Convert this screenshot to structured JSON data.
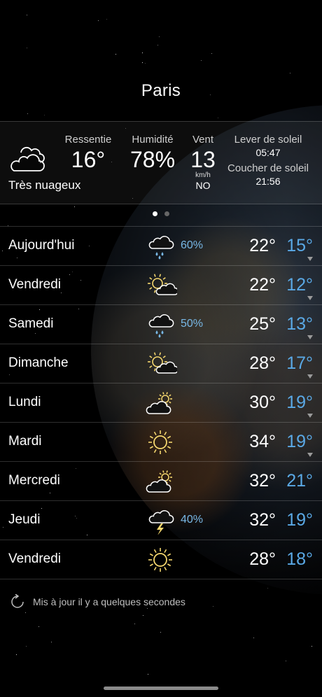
{
  "city": "Paris",
  "current": {
    "condition": "Très nuageux",
    "icon": "cloudy-icon",
    "feels_like_label": "Ressentie",
    "feels_like_value": "16°",
    "humidity_label": "Humidité",
    "humidity_value": "78%",
    "wind_label": "Vent",
    "wind_value": "13",
    "wind_unit": "km/h",
    "wind_dir": "NO",
    "sunrise_label": "Lever de soleil",
    "sunrise_time": "05:47",
    "sunset_label": "Coucher de soleil",
    "sunset_time": "21:56"
  },
  "pager": {
    "pages": 2,
    "active": 1
  },
  "forecast": [
    {
      "day": "Aujourd'hui",
      "icon": "rain-cloud-icon",
      "precip": "60%",
      "high": "22°",
      "low": "15°",
      "expand": true
    },
    {
      "day": "Vendredi",
      "icon": "sun-cloud-icon",
      "precip": "",
      "high": "22°",
      "low": "12°",
      "expand": true
    },
    {
      "day": "Samedi",
      "icon": "rain-cloud-icon",
      "precip": "50%",
      "high": "25°",
      "low": "13°",
      "expand": true
    },
    {
      "day": "Dimanche",
      "icon": "sun-cloud-icon",
      "precip": "",
      "high": "28°",
      "low": "17°",
      "expand": true
    },
    {
      "day": "Lundi",
      "icon": "cloud-sun-icon",
      "precip": "",
      "high": "30°",
      "low": "19°",
      "expand": true
    },
    {
      "day": "Mardi",
      "icon": "sun-icon",
      "precip": "",
      "high": "34°",
      "low": "19°",
      "expand": true
    },
    {
      "day": "Mercredi",
      "icon": "cloud-sun-icon",
      "precip": "",
      "high": "32°",
      "low": "21°",
      "expand": false
    },
    {
      "day": "Jeudi",
      "icon": "thunderstorm-icon",
      "precip": "40%",
      "high": "32°",
      "low": "19°",
      "expand": false
    },
    {
      "day": "Vendredi",
      "icon": "sun-icon",
      "precip": "",
      "high": "28°",
      "low": "18°",
      "expand": false
    }
  ],
  "update_text": "Mis à jour il y a quelques secondes",
  "colors": {
    "low_temp": "#5aa9e6",
    "precip": "#78b8e6",
    "sun": "#f5d76e"
  }
}
